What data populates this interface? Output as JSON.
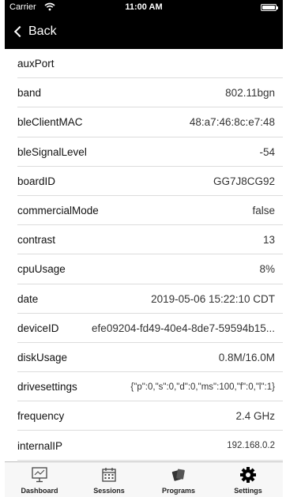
{
  "status": {
    "carrier": "Carrier",
    "time": "11:00 AM"
  },
  "nav": {
    "back_label": "Back"
  },
  "rows": [
    {
      "key": "auxPort",
      "value": ""
    },
    {
      "key": "band",
      "value": "802.11bgn"
    },
    {
      "key": "bleClientMAC",
      "value": "48:a7:46:8c:e7:48"
    },
    {
      "key": "bleSignalLevel",
      "value": "-54"
    },
    {
      "key": "boardID",
      "value": "GG7J8CG92"
    },
    {
      "key": "commercialMode",
      "value": "false"
    },
    {
      "key": "contrast",
      "value": "13"
    },
    {
      "key": "cpuUsage",
      "value": "8%"
    },
    {
      "key": "date",
      "value": "2019-05-06 15:22:10 CDT"
    },
    {
      "key": "deviceID",
      "value": "efe09204-fd49-40e4-8de7-59594b15..."
    },
    {
      "key": "diskUsage",
      "value": "0.8M/16.0M"
    },
    {
      "key": "drivesettings",
      "value": "{\"p\":0,\"s\":0,\"d\":0,\"ms\":100,\"f\":0,\"l\":1}"
    },
    {
      "key": "frequency",
      "value": "2.4 GHz"
    },
    {
      "key": "internalIP",
      "value": "192.168.0.2"
    }
  ],
  "tabs": [
    {
      "label": "Dashboard",
      "icon": "monitor-icon"
    },
    {
      "label": "Sessions",
      "icon": "calendar-icon"
    },
    {
      "label": "Programs",
      "icon": "cards-icon"
    },
    {
      "label": "Settings",
      "icon": "gear-icon"
    }
  ]
}
